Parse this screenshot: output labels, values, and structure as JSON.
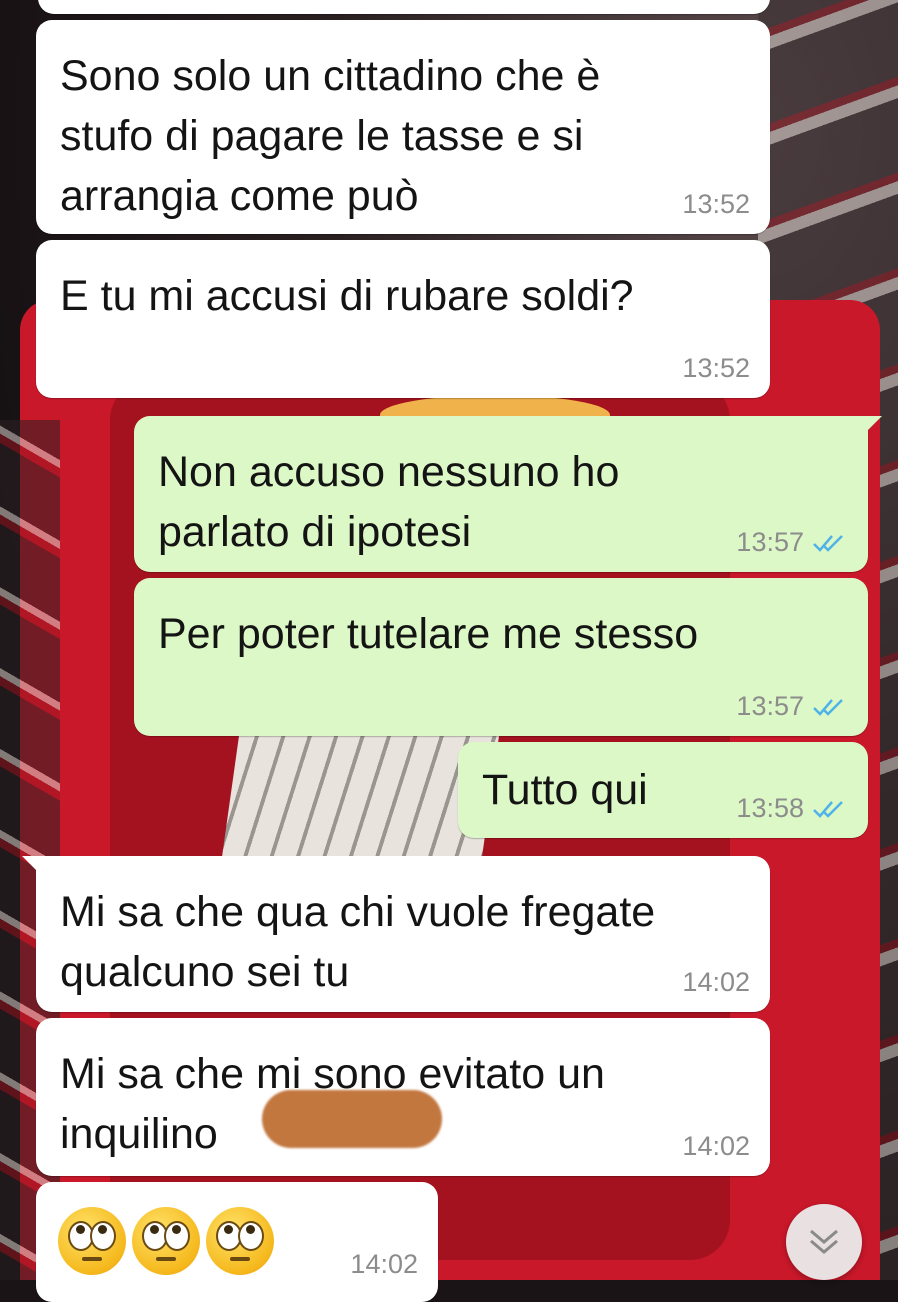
{
  "messages": [
    {
      "id": "m1",
      "direction": "in",
      "text": "Sono solo un cittadino che è\nstufo di pagare le tasse e si\narrangia come può",
      "time": "13:52"
    },
    {
      "id": "m2",
      "direction": "in",
      "text": "E tu mi accusi di rubare soldi?",
      "time": "13:52"
    },
    {
      "id": "m3",
      "direction": "out",
      "text": "Non accuso nessuno ho\nparlato di ipotesi",
      "time": "13:57",
      "status": "read"
    },
    {
      "id": "m4",
      "direction": "out",
      "text": "Per poter tutelare me stesso",
      "time": "13:57",
      "status": "read"
    },
    {
      "id": "m5",
      "direction": "out",
      "text": "Tutto qui",
      "time": "13:58",
      "status": "read"
    },
    {
      "id": "m6",
      "direction": "in",
      "text": "Mi sa che qua chi vuole fregate\nqualcuno sei tu",
      "time": "14:02"
    },
    {
      "id": "m7",
      "direction": "in",
      "text": "Mi sa che mi sono evitato un\ninquilino",
      "time": "14:02",
      "redacted_tail": true
    },
    {
      "id": "m8",
      "direction": "in",
      "emoji": [
        "face-with-rolling-eyes",
        "face-with-rolling-eyes",
        "face-with-rolling-eyes"
      ],
      "time": "14:02"
    }
  ],
  "icons": {
    "read_receipt": "double-check-icon",
    "scroll_down": "chevron-double-down-icon"
  },
  "colors": {
    "incoming_bubble": "#ffffff",
    "outgoing_bubble": "#dcf8c6",
    "read_ticks": "#4fb3e8",
    "timestamp": "#8c8c8c"
  }
}
